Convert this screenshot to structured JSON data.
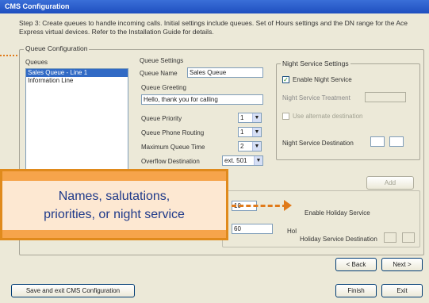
{
  "window": {
    "title": "CMS Configuration"
  },
  "instructions": "Step 3: Create queues to handle incoming calls. Initial settings include queues. Set of Hours settings and the DN range for the Ace Express virtual devices. Refer to the Installation Guide for details.",
  "queue_config": {
    "group_label": "Queue Configuration",
    "queues_label": "Queues",
    "queues": [
      "Sales Queue - Line 1",
      "Information Line"
    ],
    "selected_index": 0
  },
  "queue_settings": {
    "group_label": "Queue Settings",
    "queue_name_label": "Queue Name",
    "queue_name_value": "Sales Queue",
    "salutation_label": "Queue Greeting",
    "salutation_value": "Hello, thank you for calling",
    "queue_priority_label": "Queue Priority",
    "queue_priority_value": "1",
    "queue_phone_routing_label": "Queue Phone Routing",
    "queue_phone_routing_value": "1",
    "max_queue_time_label": "Maximum Queue Time",
    "max_queue_time_value": "2",
    "overflow_destination_label": "Overflow Destination",
    "overflow_destination_value": "ext. 501"
  },
  "night_service": {
    "group_label": "Night Service Settings",
    "enable_label": "Enable Night Service",
    "night_service_treatment_label": "Night Service Treatment",
    "use_alternate_label": "Use alternate destination",
    "night_service_destination_label": "Night Service Destination",
    "add_button": "Add"
  },
  "lower_group": {
    "value_a": "10",
    "value_b": "60",
    "label_a": "Enable Holiday Service",
    "label_b": "Hol",
    "holiday_dest_label": "Holiday Service Destination"
  },
  "callout": {
    "line1": "Names, salutations,",
    "line2": "priorities, or night service"
  },
  "footer": {
    "back_button": "< Back",
    "next_button": "Next >",
    "save_button": "Save and exit CMS Configuration",
    "finish_button": "Finish",
    "exit_button": "Exit"
  }
}
